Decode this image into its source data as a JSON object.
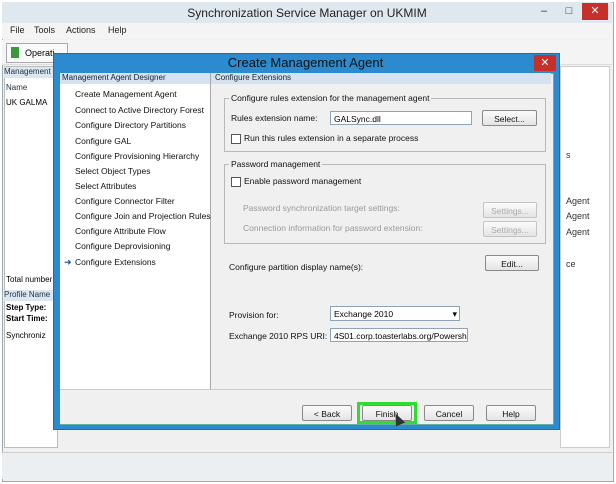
{
  "outer_window": {
    "title": "Synchronization Service Manager on UKMIM",
    "min_glyph": "–",
    "max_glyph": "□",
    "close_glyph": "✕",
    "menu": [
      "File",
      "Tools",
      "Actions",
      "Help"
    ],
    "toolbar_operations": "Operati",
    "left_panel": {
      "header": "Management",
      "col_name": "Name",
      "row1": "UK GALMA",
      "total": "Total number",
      "profile_header": "Profile Name",
      "step_type": "Step Type:",
      "start_time": "Start Time:",
      "sync_col": "Synchroniz"
    },
    "right_strip": [
      "s",
      "Agent",
      "Agent",
      "Agent",
      "ce"
    ]
  },
  "dialog": {
    "title": "Create Management Agent",
    "close_glyph": "✕",
    "nav_header": "Management Agent Designer",
    "nav_items": [
      "Create Management Agent",
      "Connect to Active Directory Forest",
      "Configure Directory Partitions",
      "Configure GAL",
      "Configure Provisioning Hierarchy",
      "Select Object Types",
      "Select Attributes",
      "Configure Connector Filter",
      "Configure Join and Projection Rules",
      "Configure Attribute Flow",
      "Configure Deprovisioning",
      "Configure Extensions"
    ],
    "nav_selected_arrow": "➜",
    "content_header": "Configure Extensions",
    "rules_group": {
      "title": "Configure rules extension for the management agent",
      "name_label": "Rules extension name:",
      "name_value": "GALSync.dll",
      "select_button": "Select...",
      "separate_process": "Run this rules extension in a separate process"
    },
    "password_group": {
      "title": "Password management",
      "enable": "Enable password management",
      "target_settings": "Password synchronization target settings:",
      "connection_info": "Connection information for password extension:",
      "settings_button_1": "Settings...",
      "settings_button_2": "Settings..."
    },
    "partition": {
      "label": "Configure partition display name(s):",
      "edit_button": "Edit..."
    },
    "provision": {
      "label": "Provision for:",
      "selected": "Exchange 2010",
      "dropdown_glyph": "▾",
      "rps_label": "Exchange 2010 RPS URI:",
      "rps_value": "4S01.corp.toasterlabs.org/Powershe"
    },
    "footer": {
      "back": "< Back",
      "finish": "Finish",
      "cancel": "Cancel",
      "help": "Help"
    }
  },
  "colors": {
    "dialog_frame": "#2c8bcf",
    "close_red": "#c7302a",
    "highlight_green": "#2fdc2f"
  }
}
